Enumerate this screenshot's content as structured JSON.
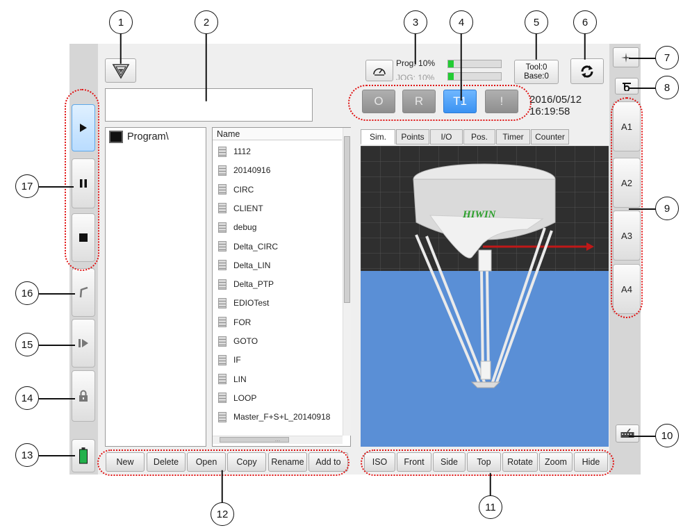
{
  "header": {
    "prog_label": "Prog: 10%",
    "jog_label": "JOG: 10%",
    "prog_percent": 10,
    "jog_percent": 10,
    "tool_label": "Tool:0",
    "base_label": "Base:0",
    "date": "2016/05/12",
    "time": "16:19:58",
    "message": ""
  },
  "modes": [
    "O",
    "R",
    "T1",
    "!"
  ],
  "active_mode": "T1",
  "program_tree": {
    "root": "Program\\"
  },
  "file_list": {
    "column_header": "Name",
    "items": [
      "1112",
      "20140916",
      "CIRC",
      "CLIENT",
      "debug",
      "Delta_CIRC",
      "Delta_LIN",
      "Delta_PTP",
      "EDIOTest",
      "FOR",
      "GOTO",
      "IF",
      "LIN",
      "LOOP",
      "Master_F+S+L_20140918"
    ],
    "hscroll_label": "…"
  },
  "tabs": [
    "Sim.",
    "Points",
    "I/O",
    "Pos.",
    "Timer",
    "Counter"
  ],
  "active_tab": "Sim.",
  "robot_brand": "HIWIN",
  "axis_buttons": [
    "A1",
    "A2",
    "A3",
    "A4"
  ],
  "file_buttons": [
    "New",
    "Delete",
    "Open",
    "Copy",
    "Rename",
    "Add to"
  ],
  "view_buttons": [
    "ISO",
    "Front",
    "Side",
    "Top",
    "Rotate",
    "Zoom",
    "Hide"
  ],
  "callouts": [
    "1",
    "2",
    "3",
    "4",
    "5",
    "6",
    "7",
    "8",
    "9",
    "10",
    "11",
    "12",
    "13",
    "14",
    "15",
    "16",
    "17"
  ],
  "colors": {
    "active_blue": "#4da3ff",
    "callout_dotted_red": "#e01010",
    "floor_blue": "#5a8fd6",
    "battery_green": "#22b14c"
  }
}
